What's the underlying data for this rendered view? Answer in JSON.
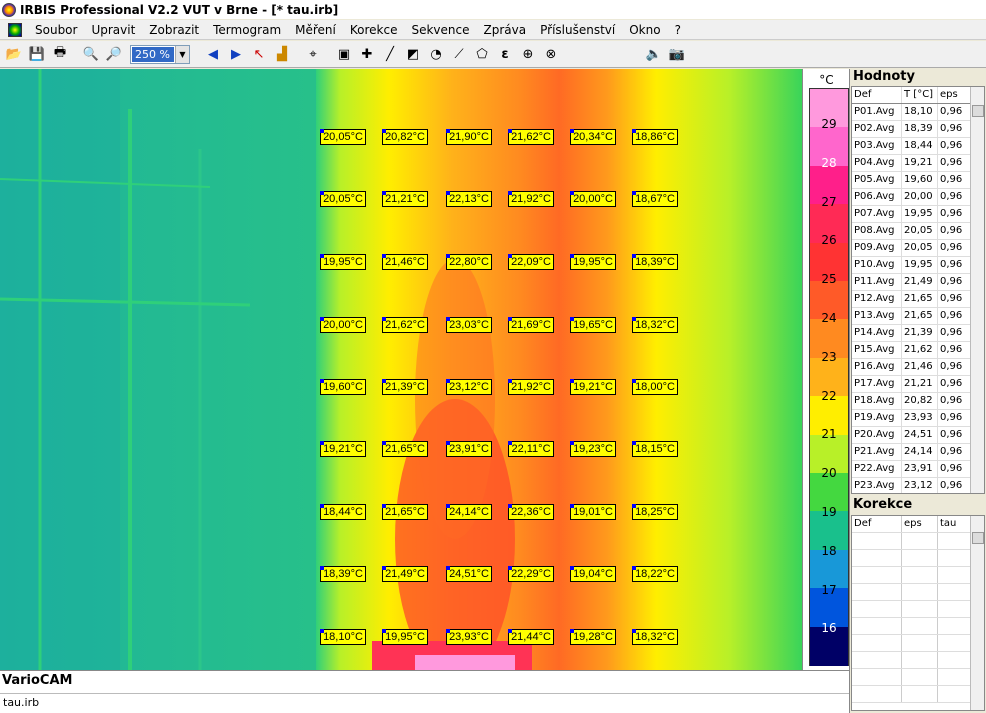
{
  "window": {
    "title": "IRBIS Professional V2.2   VUT v Brne - [* tau.irb]"
  },
  "menu": [
    "Soubor",
    "Upravit",
    "Zobrazit",
    "Termogram",
    "Měření",
    "Korekce",
    "Sekvence",
    "Zpráva",
    "Příslušenství",
    "Okno",
    "?"
  ],
  "toolbar": {
    "zoom": "250 %"
  },
  "scale": {
    "unit": "°C",
    "ticks": [
      "29",
      "28",
      "27",
      "26",
      "25",
      "24",
      "23",
      "22",
      "21",
      "20",
      "19",
      "18",
      "17",
      "16"
    ],
    "colors": [
      "#ff99dd",
      "#ff66cc",
      "#ff1f8a",
      "#ff2a55",
      "#ff3333",
      "#ff5a28",
      "#ff8a20",
      "#ffb21a",
      "#ffee00",
      "#b8f028",
      "#44d840",
      "#19c08c",
      "#1898d8",
      "#0055dd",
      "#000066"
    ]
  },
  "markers": [
    [
      "20,05°C",
      "20,82°C",
      "21,90°C",
      "21,62°C",
      "20,34°C",
      "18,86°C"
    ],
    [
      "20,05°C",
      "21,21°C",
      "22,13°C",
      "21,92°C",
      "20,00°C",
      "18,67°C"
    ],
    [
      "19,95°C",
      "21,46°C",
      "22,80°C",
      "22,09°C",
      "19,95°C",
      "18,39°C"
    ],
    [
      "20,00°C",
      "21,62°C",
      "23,03°C",
      "21,69°C",
      "19,65°C",
      "18,32°C"
    ],
    [
      "19,60°C",
      "21,39°C",
      "23,12°C",
      "21,92°C",
      "19,21°C",
      "18,00°C"
    ],
    [
      "19,21°C",
      "21,65°C",
      "23,91°C",
      "22,11°C",
      "19,23°C",
      "18,15°C"
    ],
    [
      "18,44°C",
      "21,65°C",
      "24,14°C",
      "22,36°C",
      "19,01°C",
      "18,25°C"
    ],
    [
      "18,39°C",
      "21,49°C",
      "24,51°C",
      "22,29°C",
      "19,04°C",
      "18,22°C"
    ],
    [
      "18,10°C",
      "19,95°C",
      "23,93°C",
      "21,44°C",
      "19,28°C",
      "18,32°C"
    ]
  ],
  "caption": {
    "camera": "VarioCAM",
    "file": "tau.irb"
  },
  "hodnoty": {
    "title": "Hodnoty",
    "headers": [
      "Def",
      "T [°C]",
      "eps"
    ],
    "rows": [
      [
        "P01.Avg",
        "18,10",
        "0,96"
      ],
      [
        "P02.Avg",
        "18,39",
        "0,96"
      ],
      [
        "P03.Avg",
        "18,44",
        "0,96"
      ],
      [
        "P04.Avg",
        "19,21",
        "0,96"
      ],
      [
        "P05.Avg",
        "19,60",
        "0,96"
      ],
      [
        "P06.Avg",
        "20,00",
        "0,96"
      ],
      [
        "P07.Avg",
        "19,95",
        "0,96"
      ],
      [
        "P08.Avg",
        "20,05",
        "0,96"
      ],
      [
        "P09.Avg",
        "20,05",
        "0,96"
      ],
      [
        "P10.Avg",
        "19,95",
        "0,96"
      ],
      [
        "P11.Avg",
        "21,49",
        "0,96"
      ],
      [
        "P12.Avg",
        "21,65",
        "0,96"
      ],
      [
        "P13.Avg",
        "21,65",
        "0,96"
      ],
      [
        "P14.Avg",
        "21,39",
        "0,96"
      ],
      [
        "P15.Avg",
        "21,62",
        "0,96"
      ],
      [
        "P16.Avg",
        "21,46",
        "0,96"
      ],
      [
        "P17.Avg",
        "21,21",
        "0,96"
      ],
      [
        "P18.Avg",
        "20,82",
        "0,96"
      ],
      [
        "P19.Avg",
        "23,93",
        "0,96"
      ],
      [
        "P20.Avg",
        "24,51",
        "0,96"
      ],
      [
        "P21.Avg",
        "24,14",
        "0,96"
      ],
      [
        "P22.Avg",
        "23,91",
        "0,96"
      ],
      [
        "P23.Avg",
        "23,12",
        "0,96"
      ]
    ]
  },
  "korekce": {
    "title": "Korekce",
    "headers": [
      "Def",
      "eps",
      "tau"
    ]
  }
}
